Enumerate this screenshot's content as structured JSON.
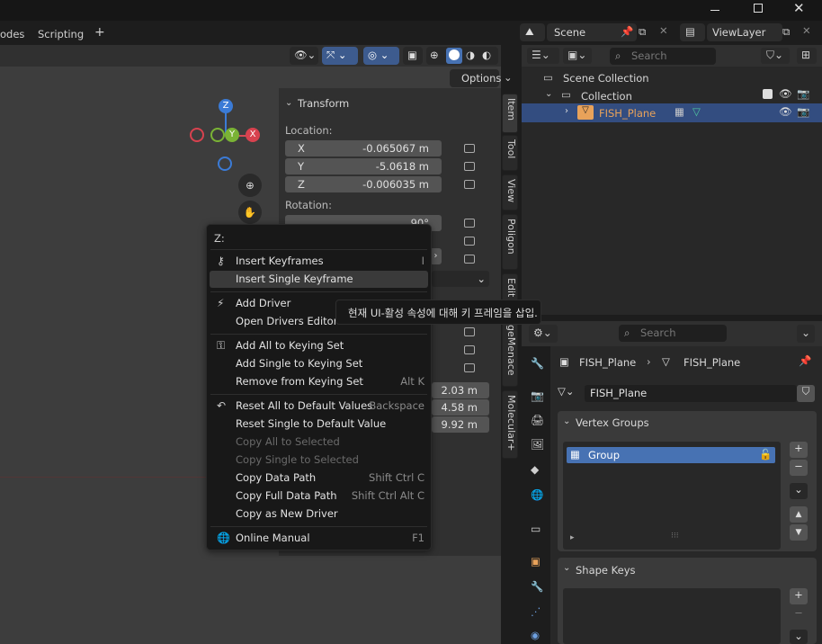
{
  "tabs": [
    "odes",
    "Scripting",
    "+"
  ],
  "scene": {
    "label": "Scene",
    "view_layer": "ViewLayer"
  },
  "viewport": {
    "options_label": "Options"
  },
  "transform": {
    "header": "Transform",
    "location_label": "Location:",
    "location": [
      {
        "axis": "X",
        "value": "-0.065067 m"
      },
      {
        "axis": "Y",
        "value": "-5.0618 m"
      },
      {
        "axis": "Z",
        "value": "-0.006035 m"
      }
    ],
    "rotation_label": "Rotation:",
    "rotation_x_partial": "90°",
    "dimensions": [
      "2.03 m",
      "4.58 m",
      "9.92 m"
    ]
  },
  "gizmo": {
    "z": "Z",
    "y": "Y",
    "x": "X"
  },
  "sidebar_tabs": [
    "Item",
    "Tool",
    "View",
    "Poligon",
    "Edit",
    "geMenace",
    "Molecular+"
  ],
  "menu": {
    "title": "Z:",
    "items": [
      {
        "label": "Insert Keyframes",
        "shortcut": "I",
        "icon": "keyframe-add-icon"
      },
      {
        "label": "Insert Single Keyframe",
        "shortcut": "",
        "icon": ""
      },
      {
        "label": "Add Driver",
        "shortcut": "",
        "icon": "driver-icon"
      },
      {
        "label": "Open Drivers Editor",
        "shortcut": "",
        "icon": ""
      },
      {
        "label": "Add All to Keying Set",
        "shortcut": "",
        "icon": "keying-set-icon"
      },
      {
        "label": "Add Single to Keying Set",
        "shortcut": "",
        "icon": ""
      },
      {
        "label": "Remove from Keying Set",
        "shortcut": "Alt K",
        "icon": ""
      },
      {
        "label": "Reset All to Default Values",
        "shortcut": "Backspace",
        "icon": "undo-icon"
      },
      {
        "label": "Reset Single to Default Value",
        "shortcut": "",
        "icon": ""
      },
      {
        "label": "Copy All to Selected",
        "shortcut": "",
        "icon": ""
      },
      {
        "label": "Copy Single to Selected",
        "shortcut": "",
        "icon": ""
      },
      {
        "label": "Copy Data Path",
        "shortcut": "Shift Ctrl C",
        "icon": ""
      },
      {
        "label": "Copy Full Data Path",
        "shortcut": "Shift Ctrl Alt C",
        "icon": ""
      },
      {
        "label": "Copy as New Driver",
        "shortcut": "",
        "icon": ""
      },
      {
        "label": "Online Manual",
        "shortcut": "F1",
        "icon": "globe-icon"
      }
    ]
  },
  "tooltip": "현재 UI-활성 속성에 대해 키 프레임을 삽입.",
  "outliner": {
    "search_placeholder": "Search",
    "scene_collection": "Scene Collection",
    "collection": "Collection",
    "object": "FISH_Plane"
  },
  "properties": {
    "search_placeholder": "Search",
    "breadcrumb_object": "FISH_Plane",
    "breadcrumb_data": "FISH_Plane",
    "mesh_name": "FISH_Plane",
    "vertex_groups_header": "Vertex Groups",
    "group_name": "Group",
    "shape_keys_header": "Shape Keys"
  },
  "colors": {
    "accent": "#4772b3",
    "selected_row": "#334d80",
    "object_orange": "#e8a25a"
  }
}
